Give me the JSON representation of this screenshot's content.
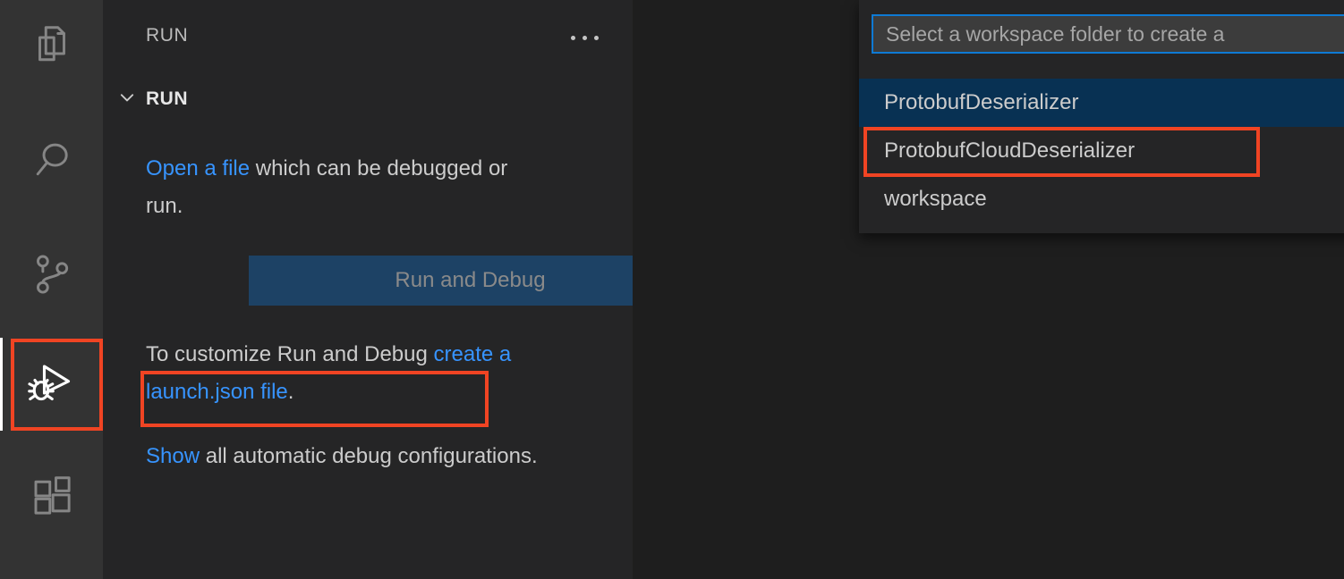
{
  "activity_bar": {
    "items": [
      {
        "name": "explorer",
        "icon": "files-icon",
        "active": false
      },
      {
        "name": "search",
        "icon": "search-icon",
        "active": false
      },
      {
        "name": "source-control",
        "icon": "source-control-icon",
        "active": false
      },
      {
        "name": "run-and-debug",
        "icon": "run-and-debug-icon",
        "active": true
      },
      {
        "name": "extensions",
        "icon": "extensions-icon",
        "active": false
      }
    ]
  },
  "side_bar": {
    "title": "RUN",
    "more_actions_icon": "ellipsis-icon",
    "section": {
      "chevron_icon": "chevron-down-icon",
      "label": "RUN"
    },
    "welcome": {
      "open_link": "Open a file",
      "open_rest": " which can be debugged or run.",
      "run_debug_button": "Run and Debug",
      "customize_text": "To customize Run and Debug ",
      "customize_link": "create a launch.json file",
      "customize_period": ".",
      "show_link": "Show",
      "show_rest": " all automatic debug configurations."
    }
  },
  "quick_pick": {
    "placeholder": "Select a workspace folder to create a",
    "items": [
      {
        "label": "ProtobufDeserializer",
        "selected": true
      },
      {
        "label": "ProtobufCloudDeserializer",
        "selected": false
      },
      {
        "label": "workspace",
        "selected": false
      }
    ]
  },
  "annotations": {
    "color": "#f04423",
    "boxes": [
      {
        "name": "run-and-debug-icon-highlight"
      },
      {
        "name": "create-launch-json-link-highlight"
      },
      {
        "name": "protobuf-cloud-deserializer-highlight"
      }
    ]
  },
  "colors": {
    "editor_background": "#1e1e1e",
    "sidebar_background": "#252526",
    "activity_bar_background": "#333333",
    "link": "#3794ff",
    "button_background": "#1d4265",
    "selection_background": "#083153",
    "focus_border": "#0e7ad4",
    "annotation": "#f04423"
  }
}
